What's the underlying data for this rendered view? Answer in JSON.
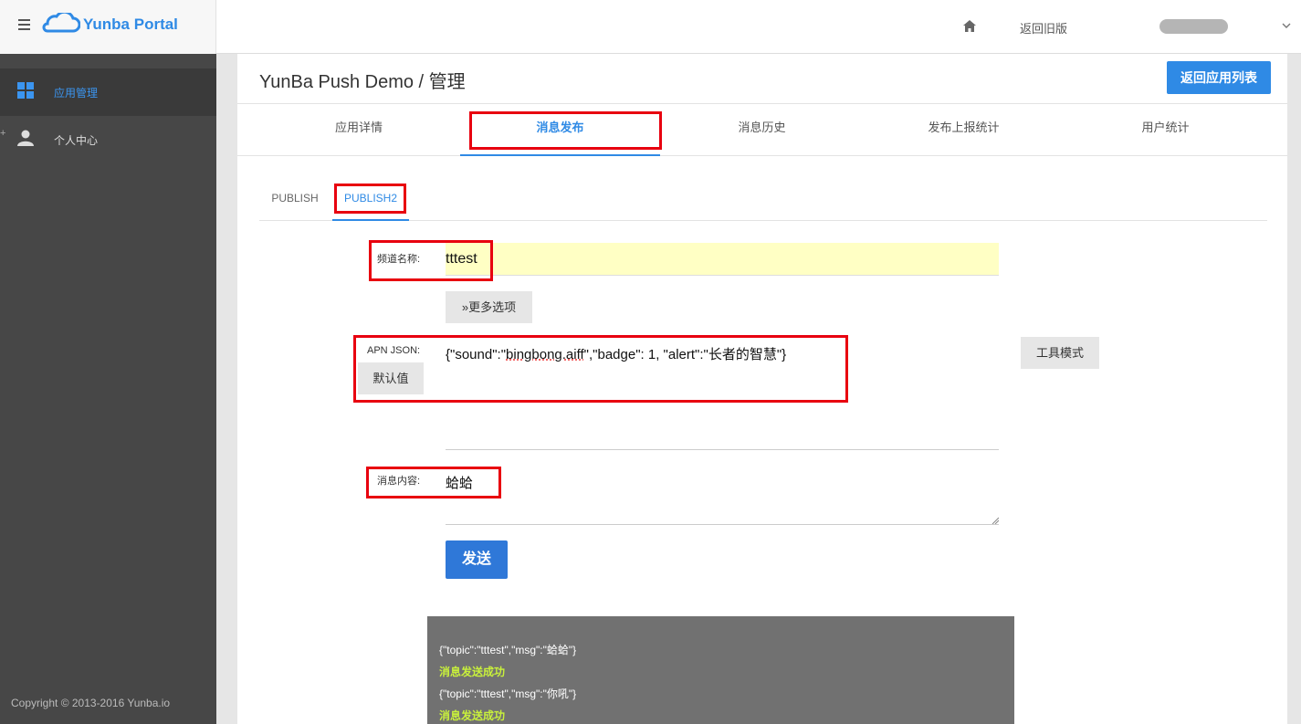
{
  "brand": {
    "name": "Yunba Portal"
  },
  "topbar": {
    "back_old_label": "返回旧版"
  },
  "sidebar": {
    "items": [
      {
        "label": "应用管理",
        "icon": "grid-icon"
      },
      {
        "label": "个人中心",
        "icon": "user-icon"
      }
    ],
    "copyright": "Copyright © 2013-2016 Yunba.io"
  },
  "page": {
    "title": "YunBa Push Demo / 管理",
    "back_list_label": "返回应用列表"
  },
  "tabs": [
    {
      "label": "应用详情"
    },
    {
      "label": "消息发布",
      "active": true
    },
    {
      "label": "消息历史"
    },
    {
      "label": "发布上报统计"
    },
    {
      "label": "用户统计"
    }
  ],
  "subtabs": [
    {
      "label": "PUBLISH"
    },
    {
      "label": "PUBLISH2",
      "active": true
    }
  ],
  "form": {
    "channel_label": "频道名称:",
    "channel_value": "tttest",
    "more_options_label": "更多选项",
    "apn_label": "APN JSON:",
    "default_label": "默认值",
    "apn_value_prefix": "{\"sound\":\"",
    "apn_value_spell": "bingbong.aiff",
    "apn_value_suffix": "\",\"badge\": 1, \"alert\":\"长者的智慧\"}",
    "tool_mode_label": "工具模式",
    "message_label": "消息内容:",
    "message_value": "蛤蛤",
    "send_label": "发送"
  },
  "console": {
    "lines": [
      {
        "text": "{\"topic\":\"tttest\",\"msg\":\"蛤蛤\"}",
        "kind": "payload"
      },
      {
        "text": "消息发送成功",
        "kind": "ok"
      },
      {
        "text": "{\"topic\":\"tttest\",\"msg\":\"你吼\"}",
        "kind": "payload"
      },
      {
        "text": "消息发送成功",
        "kind": "ok"
      }
    ]
  },
  "colors": {
    "accent": "#2f8ae5",
    "highlight_box": "#e8000f",
    "success": "#c8f03c"
  }
}
